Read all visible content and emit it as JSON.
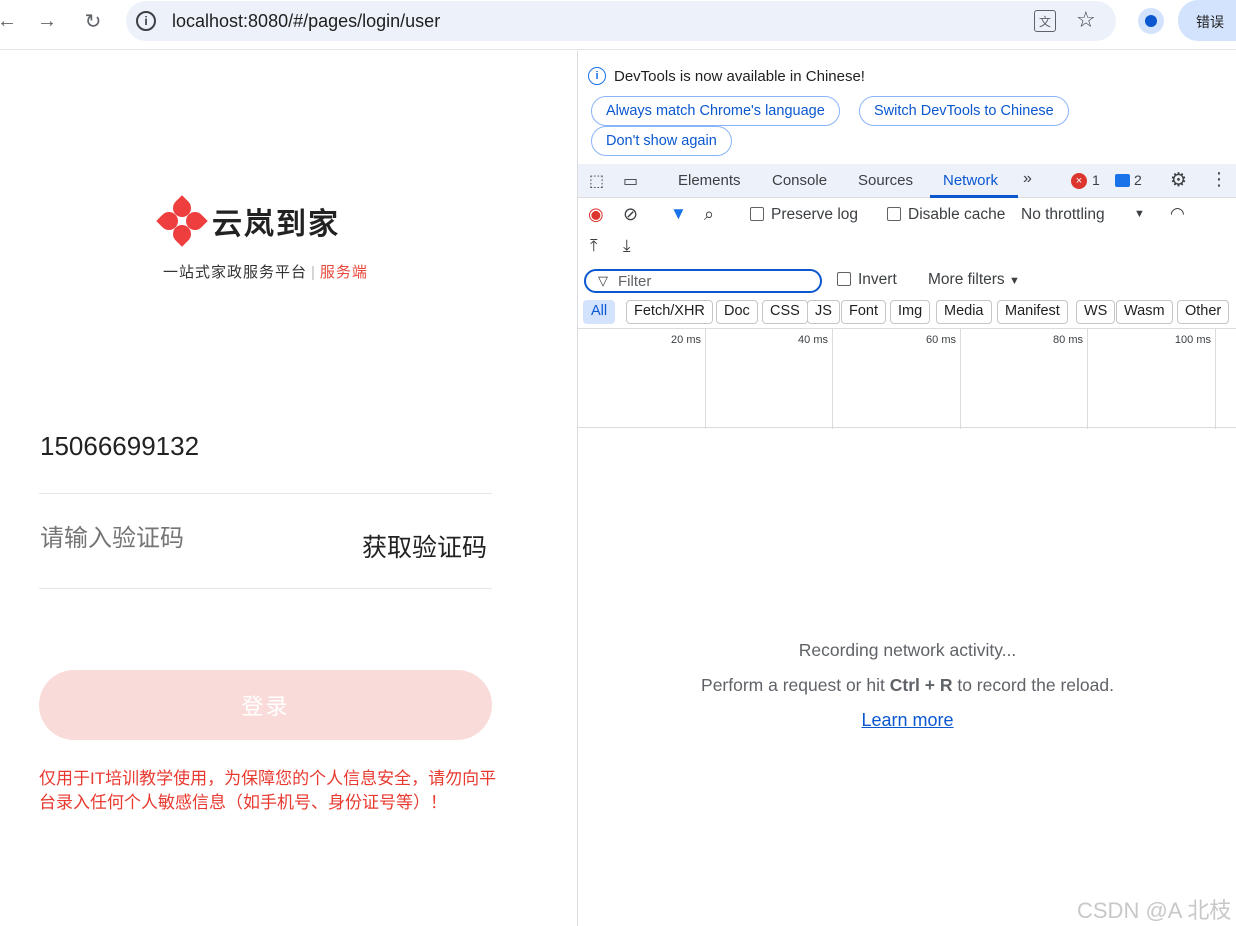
{
  "browser": {
    "url": "localhost:8080/#/pages/login/user",
    "error_button": "错误"
  },
  "app": {
    "brand": "云岚到家",
    "tagline_main": "一站式家政服务平台",
    "tagline_separator": "|",
    "tagline_sub": "服务端",
    "phone_value": "15066699132",
    "code_placeholder": "请输入验证码",
    "get_code_label": "获取验证码",
    "login_label": "登录",
    "warning": "仅用于IT培训教学使用，为保障您的个人信息安全，请勿向平台录入任何个人敏感信息（如手机号、身份证号等）！",
    "colors": {
      "brand_red": "#e8473b",
      "login_bg": "#f9dcd9"
    }
  },
  "devtools": {
    "info_text": "DevTools is now available in Chinese!",
    "pill_match": "Always match Chrome's language",
    "pill_switch": "Switch DevTools to Chinese",
    "pill_dismiss": "Don't show again",
    "tabs": [
      "Elements",
      "Console",
      "Sources",
      "Network"
    ],
    "active_tab": "Network",
    "error_count": "1",
    "message_count": "2",
    "preserve_log": "Preserve log",
    "disable_cache": "Disable cache",
    "throttling": "No throttling",
    "filter_placeholder": "Filter",
    "invert": "Invert",
    "more_filters": "More filters",
    "chips": [
      "All",
      "Fetch/XHR",
      "Doc",
      "CSS",
      "JS",
      "Font",
      "Img",
      "Media",
      "Manifest",
      "WS",
      "Wasm",
      "Other"
    ],
    "timeline_ticks": [
      "20 ms",
      "40 ms",
      "60 ms",
      "80 ms",
      "100 ms"
    ],
    "empty_line1": "Recording network activity...",
    "empty_line2_pre": "Perform a request or hit ",
    "empty_line2_keys": "Ctrl + R",
    "empty_line2_post": " to record the reload.",
    "learn_more": "Learn more"
  },
  "watermark": "CSDN @A 北枝"
}
